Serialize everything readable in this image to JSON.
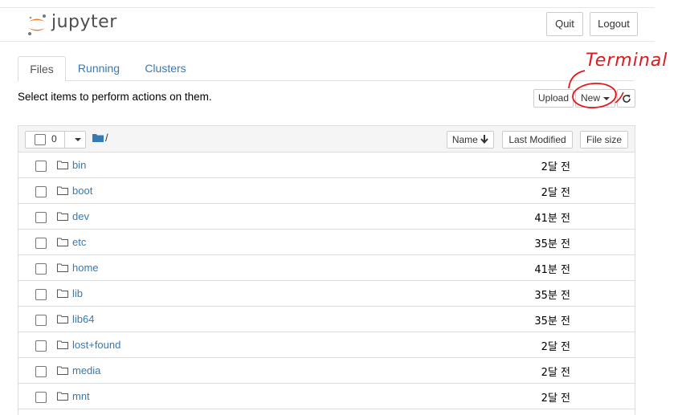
{
  "app": {
    "logo_text": "jupyter"
  },
  "header": {
    "quit_label": "Quit",
    "logout_label": "Logout"
  },
  "tabs": [
    {
      "label": "Files",
      "active": true
    },
    {
      "label": "Running",
      "active": false
    },
    {
      "label": "Clusters",
      "active": false
    }
  ],
  "toolbar": {
    "hint": "Select items to perform actions on them.",
    "upload_label": "Upload",
    "new_label": "New",
    "refresh_icon": "refresh-icon"
  },
  "list_header": {
    "selected_count": "0",
    "path": "/",
    "sort_name_label": "Name",
    "sort_modified_label": "Last Modified",
    "sort_size_label": "File size"
  },
  "files": [
    {
      "name": "bin",
      "modified": "2달 전"
    },
    {
      "name": "boot",
      "modified": "2달 전"
    },
    {
      "name": "dev",
      "modified": "41분 전"
    },
    {
      "name": "etc",
      "modified": "35분 전"
    },
    {
      "name": "home",
      "modified": "41분 전"
    },
    {
      "name": "lib",
      "modified": "35분 전"
    },
    {
      "name": "lib64",
      "modified": "35분 전"
    },
    {
      "name": "lost+found",
      "modified": "2달 전"
    },
    {
      "name": "media",
      "modified": "2달 전"
    },
    {
      "name": "mnt",
      "modified": "2달 전"
    }
  ],
  "annotation": {
    "text": "Terminal",
    "color": "#e0191c"
  },
  "colors": {
    "link": "#337ab7",
    "logo_orange": "#f37726",
    "border": "#dddddd"
  }
}
